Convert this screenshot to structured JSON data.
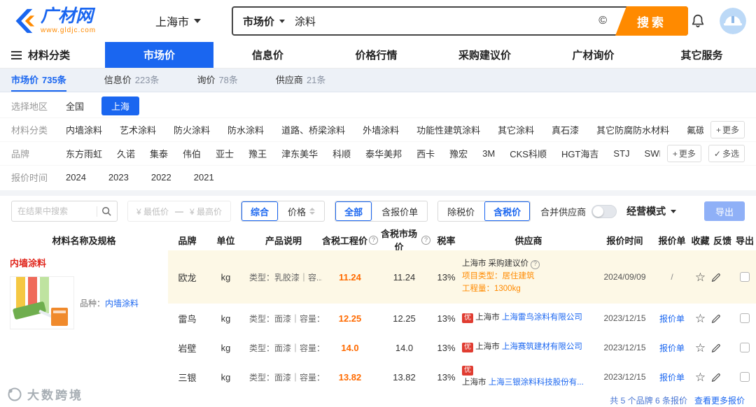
{
  "icons": {
    "help": "?",
    "check": "✓",
    "copyright": "©",
    "star": "☆",
    "plus": "+"
  },
  "header": {
    "logo_title": "广材网",
    "logo_site": "www.gldjc.com",
    "city": "上海市",
    "search": {
      "category": "市场价",
      "value": "涂料",
      "button": "搜索"
    }
  },
  "nav": {
    "catalog": "材料分类",
    "tabs": [
      {
        "label": "市场价"
      },
      {
        "label": "信息价"
      },
      {
        "label": "价格行情"
      },
      {
        "label": "采购建议价"
      },
      {
        "label": "广材询价"
      },
      {
        "label": "其它服务"
      }
    ]
  },
  "subnav": {
    "items": [
      {
        "label": "市场价",
        "count": "735条"
      },
      {
        "label": "信息价",
        "count": "223条"
      },
      {
        "label": "询价",
        "count": "78条"
      },
      {
        "label": "供应商",
        "count": "21条"
      }
    ]
  },
  "filters": {
    "region": {
      "label": "选择地区",
      "all": "全国",
      "selected": "上海"
    },
    "category": {
      "label": "材料分类",
      "options": [
        "内墙涂料",
        "艺术涂料",
        "防火涂料",
        "防水涂料",
        "道路、桥梁涂料",
        "外墙涂料",
        "功能性建筑涂料",
        "其它涂料",
        "真石漆",
        "其它防腐防水材料",
        "氟碳漆"
      ],
      "more": "更多"
    },
    "brand": {
      "label": "品牌",
      "options": [
        "东方雨虹",
        "久诺",
        "集泰",
        "伟伯",
        "亚士",
        "豫王",
        "津东美华",
        "科顺",
        "泰华美邦",
        "西卡",
        "豫宏",
        "3M",
        "CKS科顺",
        "HGT海吉",
        "STJ",
        "SWD"
      ],
      "more": "更多",
      "multi": "多选"
    },
    "time": {
      "label": "报价时间",
      "options": [
        "2024",
        "2023",
        "2022",
        "2021"
      ]
    }
  },
  "toolbar": {
    "search_placeholder": "在结果中搜索",
    "min_price": "¥ 最低价",
    "dash": "—",
    "max_price": "¥ 最高价",
    "sort_composite": "综合",
    "sort_price": "价格",
    "scope_all": "全部",
    "scope_quoted": "含报价单",
    "tax_excl": "除税价",
    "tax_incl": "含税价",
    "merge_label": "合并供应商",
    "mode_label": "经营模式",
    "export_label": "导出"
  },
  "table": {
    "headers": {
      "name": "材料名称及规格",
      "brand": "品牌",
      "unit": "单位",
      "desc": "产品说明",
      "price_project": "含税工程价",
      "price_market": "含税市场价",
      "tax": "税率",
      "supplier": "供应商",
      "date": "报价时间",
      "quote": "报价单",
      "favorite": "收藏",
      "feedback": "反馈",
      "export": "导出"
    },
    "material": {
      "name": "内墙涂料",
      "variety_label": "品种：",
      "variety_value": "内墙涂料"
    },
    "rows": [
      {
        "brand": "欧龙",
        "unit": "kg",
        "desc": "类型：乳胶漆｜容...",
        "price_project": "11.24",
        "price_market": "11.24",
        "tax": "13%",
        "city": "上海市",
        "advice_tag": "采购建议价",
        "project_type": "项目类型：居住建筑",
        "quantity": "工程量：1300kg",
        "date": "2024/09/09",
        "quote": "/"
      },
      {
        "brand": "雷鸟",
        "unit": "kg",
        "desc": "类型：面漆｜容量：...",
        "price_project": "12.25",
        "price_market": "12.25",
        "tax": "13%",
        "badge": "优",
        "city": "上海市",
        "company": "上海雷鸟涂料有限公司",
        "date": "2023/12/15",
        "quote": "报价单"
      },
      {
        "brand": "岩壁",
        "unit": "kg",
        "desc": "类型：面漆｜容量：...",
        "price_project": "14.0",
        "price_market": "14.0",
        "tax": "13%",
        "badge": "优",
        "city": "上海市",
        "company": "上海赛筑建材有限公司",
        "date": "2023/12/15",
        "quote": "报价单"
      },
      {
        "brand": "三银",
        "unit": "kg",
        "desc": "类型：面漆｜容量：...",
        "price_project": "13.82",
        "price_market": "13.82",
        "tax": "13%",
        "badge": "优",
        "city": "上海市",
        "company": "上海三银涂料科技股份有...",
        "date": "2023/12/15",
        "quote": "报价单"
      }
    ],
    "footer": {
      "summary": "共 5 个品牌 6 条报价",
      "more_link": "查看更多报价"
    }
  },
  "watermark": "大数跨境"
}
